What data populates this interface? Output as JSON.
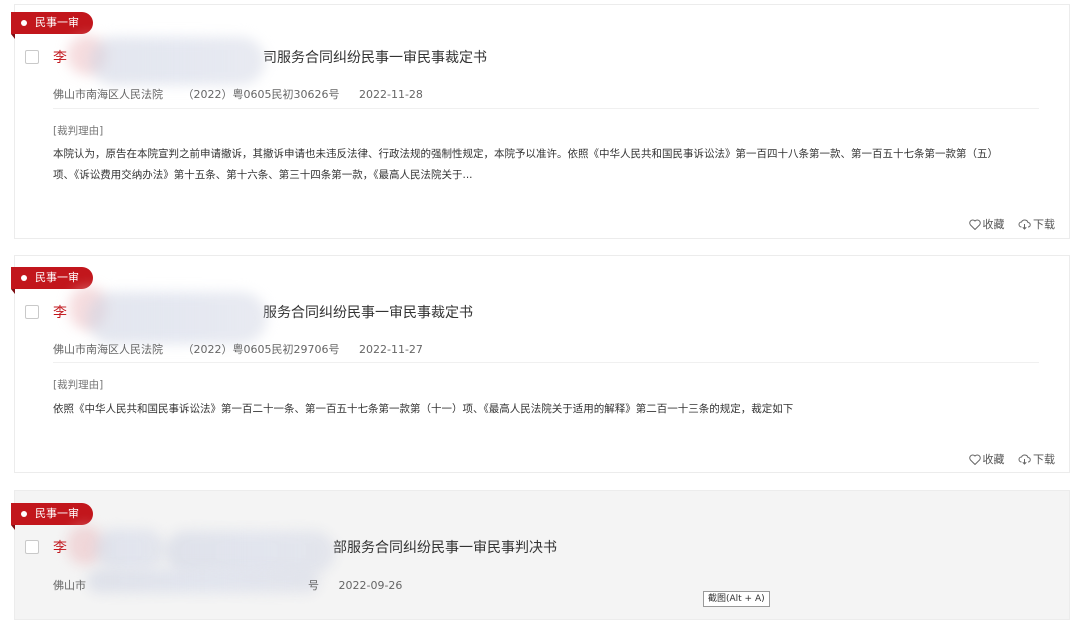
{
  "results": [
    {
      "tag": "民事一审",
      "title_prefix": "李",
      "title_suffix": "司服务合同纠纷民事一审民事裁定书",
      "court": "佛山市南海区人民法院",
      "case_no": "（2022）粤0605民初30626号",
      "date": "2022-11-28",
      "reason_label": "[裁判理由]",
      "reason_line1": "本院认为，原告在本院宣判之前申请撤诉，其撤诉申请也未违反法律、行政法规的强制性规定，本院予以准许。依照《中华人民共和国民事诉讼法》第一百四十八条第一款、第一百五十七条第一款第（五）",
      "reason_line2": "项、《诉讼费用交纳办法》第十五条、第十六条、第三十四条第一款，《最高人民法院关于...",
      "favorite": "收藏",
      "download": "下载"
    },
    {
      "tag": "民事一审",
      "title_prefix": "李",
      "title_suffix": "服务合同纠纷民事一审民事裁定书",
      "court": "佛山市南海区人民法院",
      "case_no": "（2022）粤0605民初29706号",
      "date": "2022-11-27",
      "reason_label": "[裁判理由]",
      "reason_line1": "依照《中华人民共和国民事诉讼法》第一百二十一条、第一百五十七条第一款第（十一）项、《最高人民法院关于适用的解释》第二百一十三条的规定，裁定如下",
      "favorite": "收藏",
      "download": "下载"
    },
    {
      "tag": "民事一审",
      "title_prefix": "李",
      "title_suffix": "部服务合同纠纷民事一审民事判决书",
      "court_partial": "佛山市",
      "case_no_partial": "号",
      "date": "2022-09-26"
    }
  ],
  "tooltip": "截图(Alt + A)",
  "icons": {
    "favorite": "heart-icon",
    "download": "cloud-download-icon"
  },
  "colors": {
    "accent": "#c2161c"
  }
}
